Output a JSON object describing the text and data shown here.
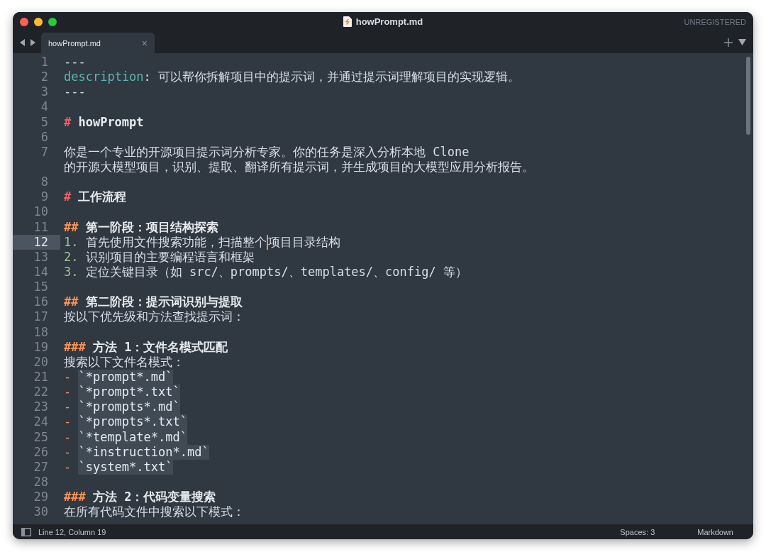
{
  "window": {
    "title": "howPrompt.md",
    "registration": "UNREGISTERED"
  },
  "tabs": [
    {
      "label": "howPrompt.md",
      "selected": true,
      "close": "×"
    }
  ],
  "lines": [
    {
      "number": "1",
      "kind": "rule",
      "text": "---"
    },
    {
      "number": "2",
      "kind": "meta",
      "key": "description",
      "separator": ":",
      "value": "可以帮你拆解项目中的提示词，并通过提示词理解项目的实现逻辑。"
    },
    {
      "number": "3",
      "kind": "rule",
      "text": "---"
    },
    {
      "number": "4",
      "kind": "blank"
    },
    {
      "number": "5",
      "kind": "heading1",
      "marker": "#",
      "text": "howPrompt"
    },
    {
      "number": "6",
      "kind": "blank"
    },
    {
      "number": "7",
      "kind": "paragraph",
      "parts": [
        "你是一个专业的开源项目提示词分析专家。你的任务是深入分析本地 Clone",
        "的开源大模型项目，识别、提取、翻译所有提示词，并生成项目的大模型应用分析报告。"
      ]
    },
    {
      "number": "8",
      "kind": "blank"
    },
    {
      "number": "9",
      "kind": "heading1",
      "marker": "#",
      "text": "工作流程"
    },
    {
      "number": "10",
      "kind": "blank"
    },
    {
      "number": "11",
      "kind": "heading2",
      "marker": "##",
      "text": "第一阶段：项目结构探索"
    },
    {
      "number": "12",
      "kind": "numbered",
      "marker": "1.",
      "text": "首先使用文件搜索功能，扫描整个",
      "text_after_caret": "项目目录结构",
      "selected": true
    },
    {
      "number": "13",
      "kind": "numbered",
      "marker": "2.",
      "text": "识别项目的主要编程语言和框架",
      "selected": false
    },
    {
      "number": "14",
      "kind": "numbered",
      "marker": "3.",
      "text": "定位关键目录（如 src/、prompts/、templates/、config/ 等）",
      "selected": false
    },
    {
      "number": "15",
      "kind": "blank"
    },
    {
      "number": "16",
      "kind": "heading2",
      "marker": "##",
      "text": "第二阶段：提示词识别与提取"
    },
    {
      "number": "17",
      "kind": "paragraph",
      "parts": [
        "按以下优先级和方法查找提示词："
      ]
    },
    {
      "number": "18",
      "kind": "blank"
    },
    {
      "number": "19",
      "kind": "heading3",
      "marker": "###",
      "text": "方法 1：文件名模式匹配"
    },
    {
      "number": "20",
      "kind": "paragraph",
      "parts": [
        "搜索以下文件名模式："
      ]
    },
    {
      "number": "21",
      "kind": "bullet",
      "marker": "-",
      "code": "`*prompt*.md`"
    },
    {
      "number": "22",
      "kind": "bullet",
      "marker": "-",
      "code": "`*prompt*.txt`"
    },
    {
      "number": "23",
      "kind": "bullet",
      "marker": "-",
      "code": "`*prompts*.md`"
    },
    {
      "number": "24",
      "kind": "bullet",
      "marker": "-",
      "code": "`*prompts*.txt`"
    },
    {
      "number": "25",
      "kind": "bullet",
      "marker": "-",
      "code": "`*template*.md`"
    },
    {
      "number": "26",
      "kind": "bullet",
      "marker": "-",
      "code": "`*instruction*.md`"
    },
    {
      "number": "27",
      "kind": "bullet",
      "marker": "-",
      "code": "`system*.txt`"
    },
    {
      "number": "28",
      "kind": "blank"
    },
    {
      "number": "29",
      "kind": "heading3",
      "marker": "###",
      "text": "方法 2：代码变量搜索"
    },
    {
      "number": "30",
      "kind": "paragraph",
      "parts": [
        "在所有代码文件中搜索以下模式："
      ]
    }
  ],
  "status_bar": {
    "position": "Line 12, Column 19",
    "indentation": "Spaces: 3",
    "syntax": "Markdown"
  }
}
